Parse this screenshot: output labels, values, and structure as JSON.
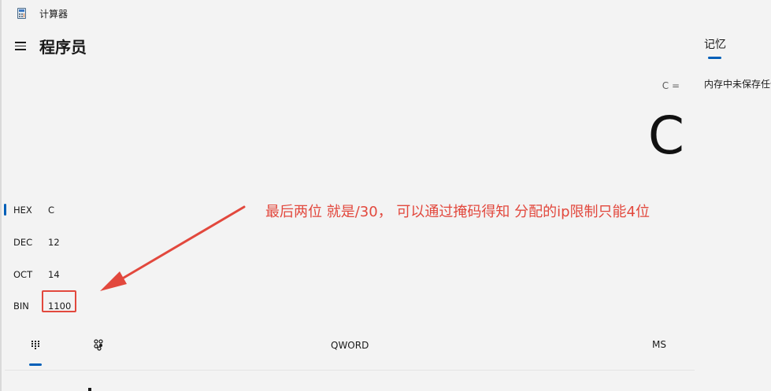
{
  "window": {
    "title": "计算器",
    "icon": "calculator-icon"
  },
  "header": {
    "menu_icon": "hamburger-menu-icon",
    "mode_title": "程序员"
  },
  "display": {
    "expression": "C =",
    "result": "C"
  },
  "radix": [
    {
      "label": "HEX",
      "value": "C",
      "selected": true
    },
    {
      "label": "DEC",
      "value": "12",
      "selected": false
    },
    {
      "label": "OCT",
      "value": "14",
      "selected": false
    },
    {
      "label": "BIN",
      "value": "1100",
      "selected": false
    }
  ],
  "annotation": {
    "text": "最后两位 就是/30， 可以通过掩码得知 分配的ip限制只能4位",
    "color": "#e2483d"
  },
  "toolbar": {
    "keypad_icon": "full-keypad-icon",
    "bitflip_icon": "bit-toggle-keypad-icon",
    "word_size": "QWORD",
    "memory_store": "MS"
  },
  "memory": {
    "tab_label": "记忆",
    "empty_text": "内存中未保存任何内容"
  },
  "colors": {
    "accent": "#005fb8",
    "background": "#f3f3f3",
    "annotation": "#e2483d"
  }
}
